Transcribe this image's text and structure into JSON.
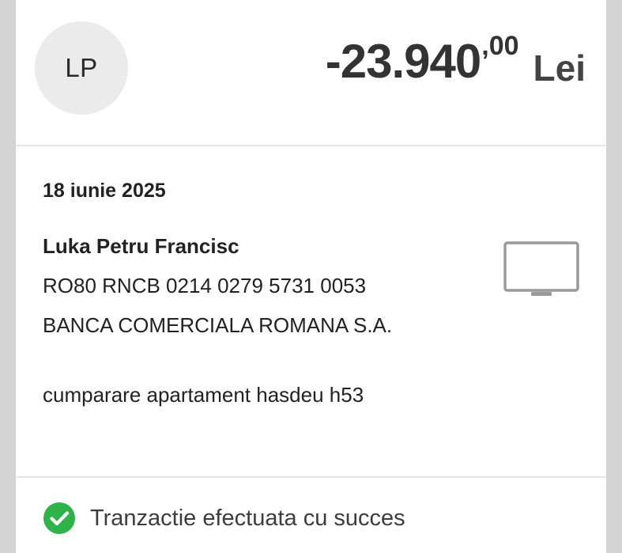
{
  "header": {
    "avatar_initials": "LP",
    "amount_integer": "-23.940",
    "amount_decimals": ",00",
    "currency": "Lei"
  },
  "details": {
    "date": "18 iunie 2025",
    "recipient_name": "Luka Petru Francisc",
    "iban": "RO80 RNCB 0214 0279 5731 0053",
    "bank": "BANCA COMERCIALA ROMANA S.A.",
    "description": "cumparare apartament hasdeu h53",
    "channel_icon": "monitor-icon"
  },
  "status": {
    "text": "Tranzactie efectuata cu succes",
    "icon": "check-circle-icon",
    "color": "#2eb34a"
  }
}
